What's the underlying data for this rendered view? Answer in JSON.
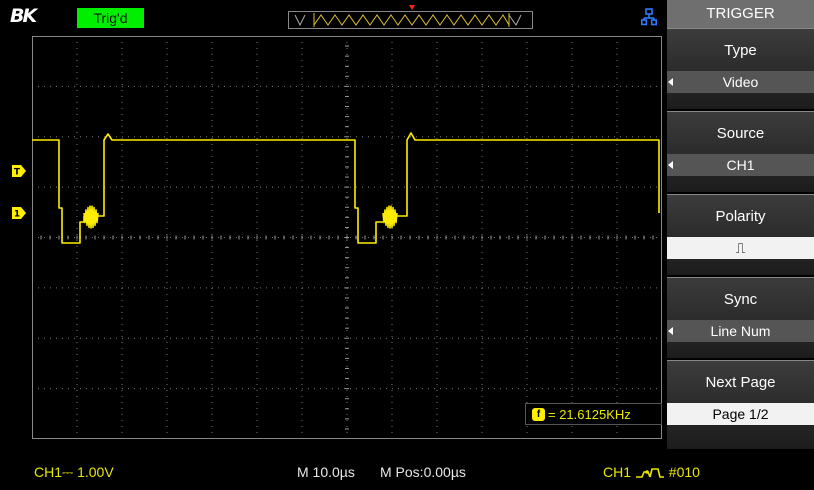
{
  "top": {
    "brand": "BK",
    "trigger_status": "Trig'd"
  },
  "trigger_menu": {
    "title": "TRIGGER",
    "items": [
      {
        "label": "Type",
        "value": "Video",
        "has_arrow": true
      },
      {
        "label": "Source",
        "value": "CH1",
        "has_arrow": true
      },
      {
        "label": "Polarity",
        "value": "⎍",
        "has_arrow": false
      },
      {
        "label": "Sync",
        "value": "Line Num",
        "has_arrow": true
      },
      {
        "label": "Next Page",
        "value": "Page 1/2",
        "has_arrow": false
      }
    ]
  },
  "measurement": {
    "frequency_icon": "f",
    "frequency": "= 21.6125KHz"
  },
  "status": {
    "ch1_scale": "CH1⎓ 1.00V",
    "time_scale": "M 10.0µs",
    "mpos": "M Pos:0.00µs",
    "trigger_source": "CH1",
    "trigger_line": "#010"
  },
  "markers": {
    "trigger_t": "T",
    "trigger_level": "T",
    "ch1_ground": "1"
  },
  "colors": {
    "trace": "#ffee00",
    "trig_status_bg": "#00ee00",
    "menu_header_bg": "#6f6f6f",
    "usb_icon": "#2a7bff",
    "grid": "#777777"
  },
  "icons": {
    "brand_logo": "bk-logo",
    "usb": "usb-icon",
    "ch1_coupling": "dc-coupling-icon",
    "edge": "trigger-edge-icon",
    "freq": "frequency-icon"
  }
}
